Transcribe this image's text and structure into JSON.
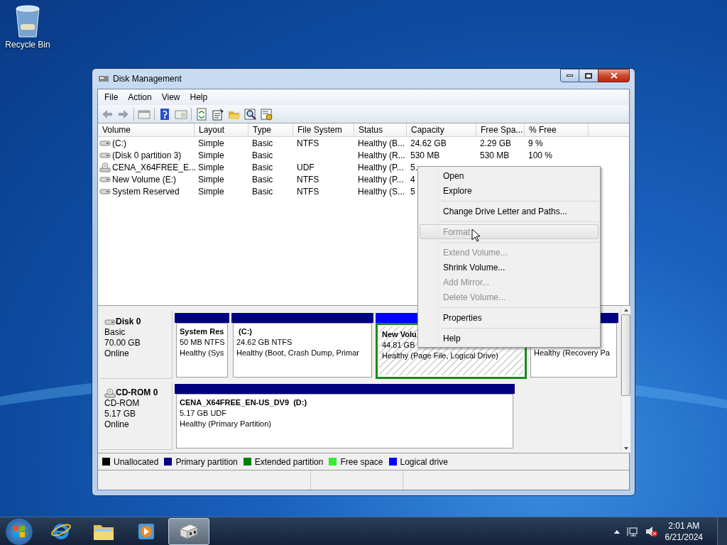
{
  "desktop_icons": [
    {
      "label": "Recycle Bin"
    }
  ],
  "window": {
    "title": "Disk Management",
    "menu": [
      "File",
      "Action",
      "View",
      "Help"
    ],
    "volume_list": {
      "columns": [
        "Volume",
        "Layout",
        "Type",
        "File System",
        "Status",
        "Capacity",
        "Free Spa...",
        "% Free"
      ],
      "rows": [
        {
          "kind": "disk",
          "cells": [
            "(C:)",
            "Simple",
            "Basic",
            "NTFS",
            "Healthy (B...",
            "24.62 GB",
            "2.29 GB",
            "9 %"
          ]
        },
        {
          "kind": "disk",
          "cells": [
            "(Disk 0 partition 3)",
            "Simple",
            "Basic",
            "",
            "Healthy (R...",
            "530 MB",
            "530 MB",
            "100 %"
          ]
        },
        {
          "kind": "cdrom",
          "cells": [
            "CENA_X64FREE_E...",
            "Simple",
            "Basic",
            "UDF",
            "Healthy (P...",
            "5.",
            "",
            ""
          ]
        },
        {
          "kind": "disk",
          "cells": [
            "New Volume (E:)",
            "Simple",
            "Basic",
            "NTFS",
            "Healthy (P...",
            "4",
            "",
            ""
          ]
        },
        {
          "kind": "disk",
          "cells": [
            "System Reserved",
            "Simple",
            "Basic",
            "NTFS",
            "Healthy (S...",
            "5",
            "",
            ""
          ]
        }
      ]
    },
    "disks": [
      {
        "kind": "disk",
        "name": "Disk 0",
        "lines": [
          "Basic",
          "70.00 GB",
          "Online"
        ],
        "partitions": [
          {
            "kind": "primary",
            "selected": false,
            "title": "System Res",
            "size": "50 MB NTFS",
            "status": "Healthy (Sys"
          },
          {
            "kind": "primary",
            "selected": false,
            "title": " (C:)",
            "size": "24.62 GB NTFS",
            "status": "Healthy (Boot, Crash Dump, Primar"
          },
          {
            "kind": "logical",
            "selected": true,
            "title": "New Volu",
            "size": "44.81 GB",
            "status": "Healthy (Page File, Logical Drive)"
          },
          {
            "kind": "primary",
            "selected": false,
            "status": "Healthy (Recovery Pa"
          }
        ]
      },
      {
        "kind": "cdrom",
        "name": "CD-ROM 0",
        "lines": [
          "CD-ROM",
          "5.17 GB",
          "Online"
        ],
        "partitions": [
          {
            "kind": "primary",
            "selected": false,
            "title": "CENA_X64FREE_EN-US_DV9  (D:)",
            "size": "5.17 GB UDF",
            "status": "Healthy (Primary Partition)"
          }
        ]
      }
    ],
    "legend": [
      {
        "label": "Unallocated",
        "color": "#000000"
      },
      {
        "label": "Primary partition",
        "color": "#000080"
      },
      {
        "label": "Extended partition",
        "color": "#008000"
      },
      {
        "label": "Free space",
        "color": "#33ee33"
      },
      {
        "label": "Logical drive",
        "color": "#0000ff"
      }
    ]
  },
  "context_menu": {
    "items": [
      {
        "kind": "item",
        "label": "Open",
        "disabled": false,
        "selected": false
      },
      {
        "kind": "item",
        "label": "Explore",
        "disabled": false,
        "selected": false
      },
      {
        "kind": "separator"
      },
      {
        "kind": "item",
        "label": "Change Drive Letter and Paths...",
        "disabled": false,
        "selected": false
      },
      {
        "kind": "separator"
      },
      {
        "kind": "item",
        "label": "Format",
        "disabled": true,
        "selected": true
      },
      {
        "kind": "separator"
      },
      {
        "kind": "item",
        "label": "Extend Volume...",
        "disabled": true,
        "selected": false
      },
      {
        "kind": "item",
        "label": "Shrink Volume...",
        "disabled": false,
        "selected": false
      },
      {
        "kind": "item",
        "label": "Add Mirror...",
        "disabled": true,
        "selected": false
      },
      {
        "kind": "item",
        "label": "Delete Volume...",
        "disabled": true,
        "selected": false
      },
      {
        "kind": "separator"
      },
      {
        "kind": "item",
        "label": "Properties",
        "disabled": false,
        "selected": false
      },
      {
        "kind": "separator"
      },
      {
        "kind": "item",
        "label": "Help",
        "disabled": false,
        "selected": false
      }
    ]
  },
  "taskbar": {
    "apps": [
      {
        "kind": "browser",
        "selected": false
      },
      {
        "kind": "folder",
        "selected": false
      },
      {
        "kind": "media",
        "selected": false
      },
      {
        "kind": "disk",
        "selected": true
      }
    ],
    "time": "2:01 AM",
    "date": "6/21/2024"
  }
}
